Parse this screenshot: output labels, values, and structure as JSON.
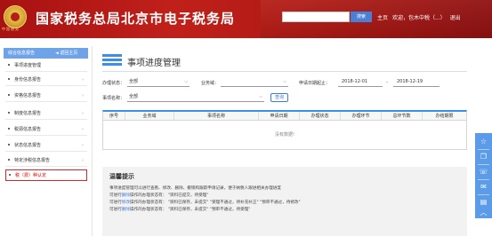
{
  "header": {
    "emblem_text": "中国税务",
    "title": "国家税务总局北京市电子税务局",
    "search_button": "搜索",
    "links": [
      "主页",
      "欢迎，包木中税（...）",
      "退出"
    ]
  },
  "sidebar": {
    "head_label": "综合信息报告",
    "back_label": "◄ 返回主页",
    "items": [
      {
        "label": "事项进度管理"
      },
      {
        "label": "身份信息报告"
      },
      {
        "label": "资格信息报告"
      },
      {
        "label": "制度信息报告"
      },
      {
        "label": "税源信息报告"
      },
      {
        "label": "状态信息报告"
      },
      {
        "label": "特定涉税信息报告"
      },
      {
        "label": "税（费）种认定"
      }
    ]
  },
  "main": {
    "page_title": "事项进度管理",
    "filters": {
      "status_label": "办理状态：",
      "status_value": "全部",
      "business_label": "业务域：",
      "business_value": "",
      "date_label": "申请日期起止：",
      "date_from": "2018-12-01",
      "date_sep": "-",
      "date_to": "2018-12-19",
      "item_label": "事项名称：",
      "item_value": "全部",
      "query_button": "查询"
    },
    "table": {
      "columns": [
        "序号",
        "业务域",
        "事项名称",
        "申请日期",
        "办理状态",
        "办理环节",
        "总环节数",
        "办结期限"
      ],
      "empty_text": "没有数据!"
    },
    "tips": {
      "title": "温馨提示",
      "lines": [
        {
          "pre": "事项进度管理可以进行查看、修改、删除、撤销和跟踪申请记录，便于纳税人跟进相关办理进度",
          "hl": "",
          "post": ""
        },
        {
          "pre": "可进行",
          "hl": "删除",
          "post": "操作的办理状态有：  \"资料已提交，待受理\""
        },
        {
          "pre": "可进行",
          "hl": "修改",
          "post": "操作的办理状态有：  \"资料已保存，未提交\"   \"受理不通过，待补充补正\"   \"预审不通过，待修改\""
        },
        {
          "pre": "可进行",
          "hl": "删除",
          "post": "操作的办理状态有：  \"资料已保存，未提交\"   \"预审不通过，待受理\""
        }
      ]
    }
  },
  "float_bar": {
    "icons": [
      "star-icon",
      "copy-icon",
      "phone-icon",
      "chat-icon",
      "document-icon",
      "up-arrow-icon"
    ]
  }
}
